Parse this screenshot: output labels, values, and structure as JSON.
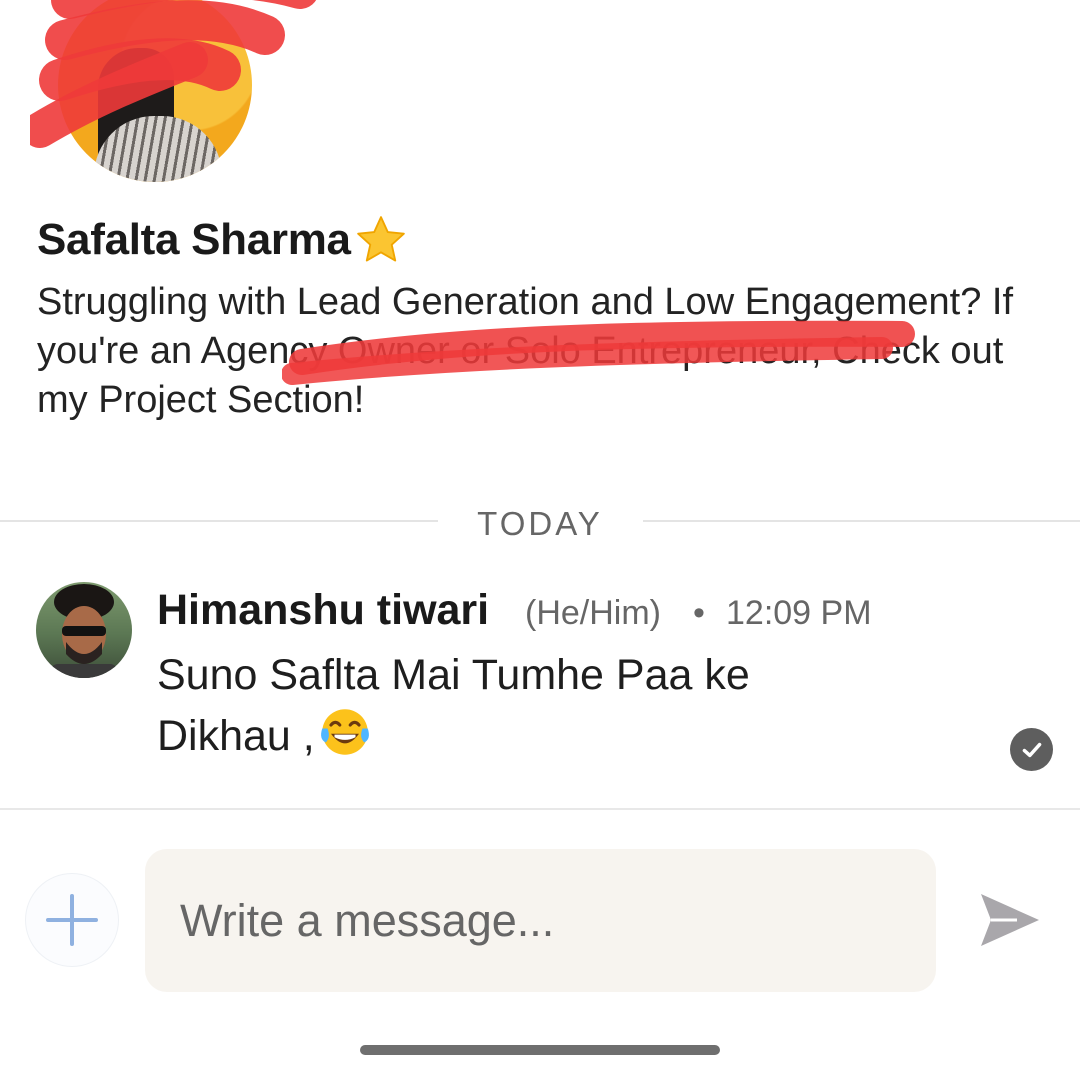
{
  "profile": {
    "name": "Safalta Sharma",
    "headline": "Struggling with Lead Generation and Low Engagement? If you're an Agency Owner or Solo Entrepreneur, Check out my Project Section!",
    "accent_color": "#f3a81d",
    "redaction_color": "#ee3a3a"
  },
  "divider": {
    "label": "TODAY"
  },
  "messages": [
    {
      "sender": "Himanshu tiwari",
      "pronouns": "(He/Him)",
      "separator": "•",
      "time": "12:09 PM",
      "text": "Suno Saflta Mai Tumhe Paa ke Dikhau ,",
      "emoji_icon": "face-with-tears-of-joy-icon",
      "status_icon": "read-check-icon"
    }
  ],
  "composer": {
    "placeholder": "Write a message...",
    "attach_icon": "plus-icon",
    "send_icon": "send-icon",
    "attach_color": "#8fb1e0",
    "send_color": "#a9a7ab"
  }
}
